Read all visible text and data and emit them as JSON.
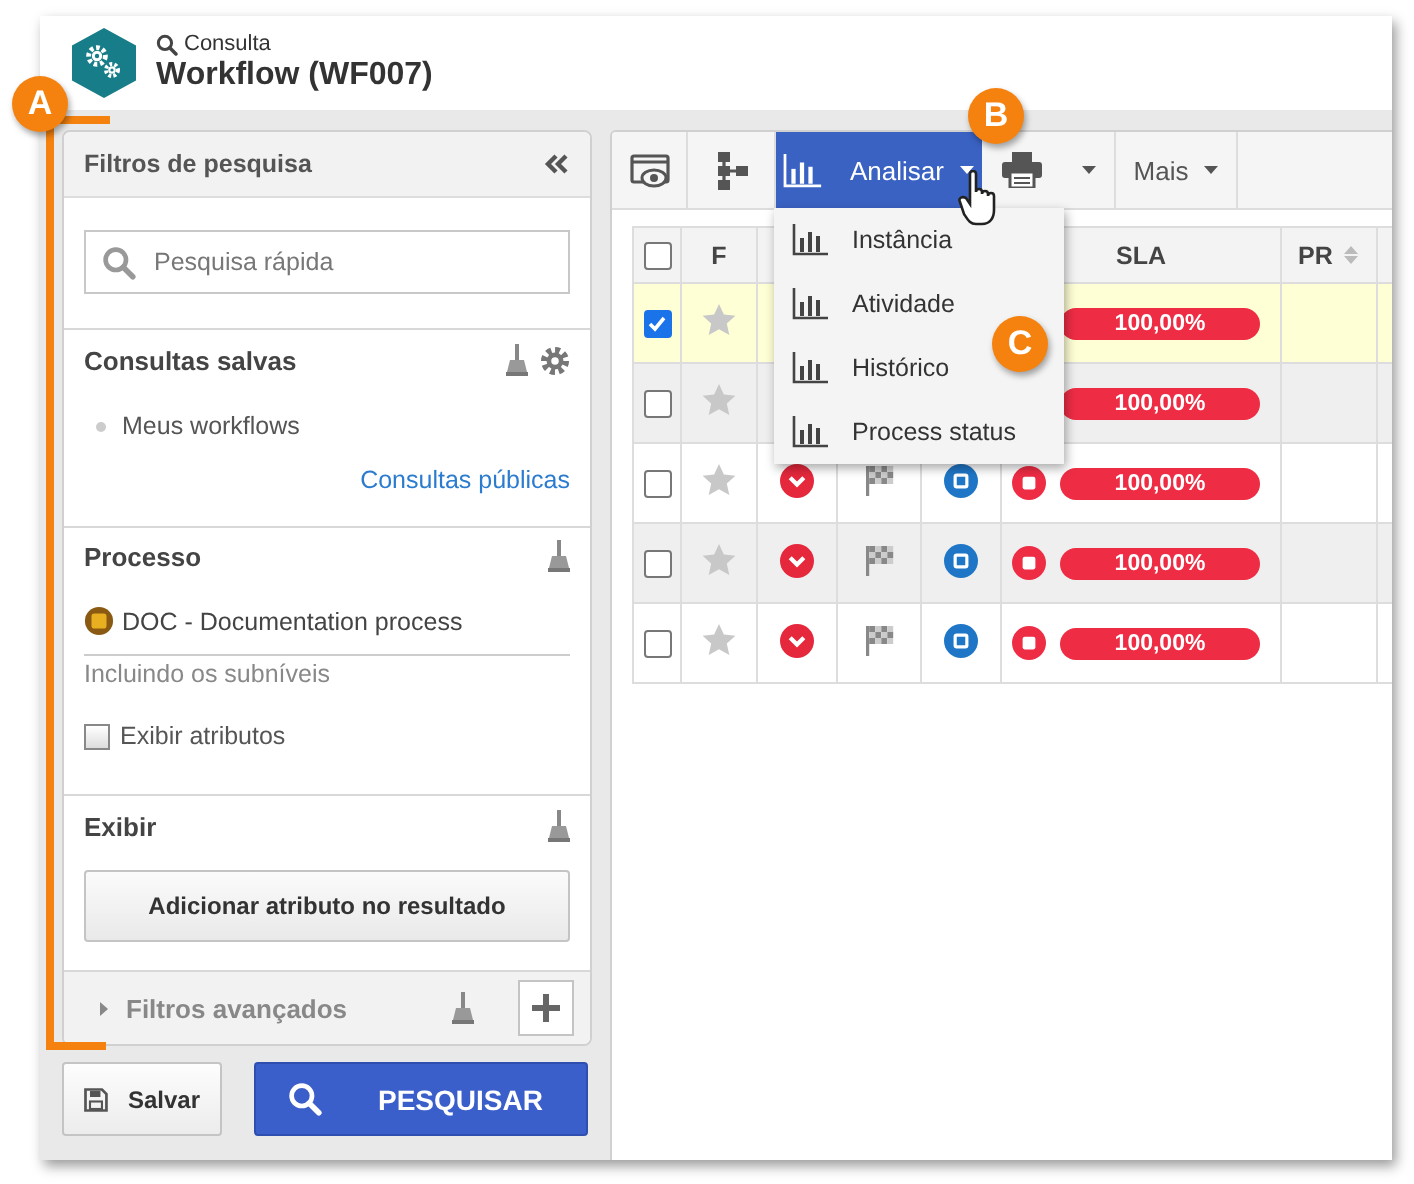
{
  "header": {
    "subtitle": "Consulta",
    "title": "Workflow (WF007)"
  },
  "filters": {
    "title": "Filtros de pesquisa",
    "search": {
      "placeholder": "Pesquisa rápida"
    },
    "saved": {
      "title": "Consultas salvas",
      "items": [
        "Meus workflows"
      ],
      "link": "Consultas públicas"
    },
    "process": {
      "title": "Processo",
      "value": "DOC - Documentation process",
      "note": "Incluindo os subníveis",
      "show_attributes": {
        "label": "Exibir atributos",
        "checked": false
      }
    },
    "display": {
      "title": "Exibir",
      "button": "Adicionar atributo no resultado"
    },
    "advanced": {
      "label": "Filtros avançados",
      "expanded": false
    }
  },
  "actions": [
    {
      "kind": "save",
      "label": "Salvar"
    },
    {
      "kind": "search",
      "label": "PESQUISAR"
    }
  ],
  "toolbar": {
    "buttons": [
      {
        "kind": "view",
        "selected": false
      },
      {
        "kind": "hierarchy",
        "selected": false
      },
      {
        "kind": "analyze",
        "label": "Analisar",
        "selected": true
      },
      {
        "kind": "print",
        "selected": false
      },
      {
        "kind": "more",
        "label": "Mais",
        "selected": false
      }
    ]
  },
  "menu": {
    "items": [
      "Instância",
      "Atividade",
      "Histórico",
      "Process status"
    ]
  },
  "table": {
    "all_checked": false,
    "columns": [
      {
        "label": "F",
        "sortable": false
      },
      {
        "label": "SLA",
        "sortable": false
      },
      {
        "label": "PR",
        "sortable": true
      }
    ],
    "rows": [
      {
        "checked": true,
        "selected": true,
        "starred": false,
        "sla": "100,00%"
      },
      {
        "checked": false,
        "selected": false,
        "starred": false,
        "sla": "100,00%"
      },
      {
        "checked": false,
        "selected": false,
        "starred": false,
        "sla": "100,00%"
      },
      {
        "checked": false,
        "selected": false,
        "starred": false,
        "sla": "100,00%"
      },
      {
        "checked": false,
        "selected": false,
        "starred": false,
        "sla": "100,00%"
      }
    ]
  },
  "callouts": [
    "A",
    "B",
    "C"
  ]
}
